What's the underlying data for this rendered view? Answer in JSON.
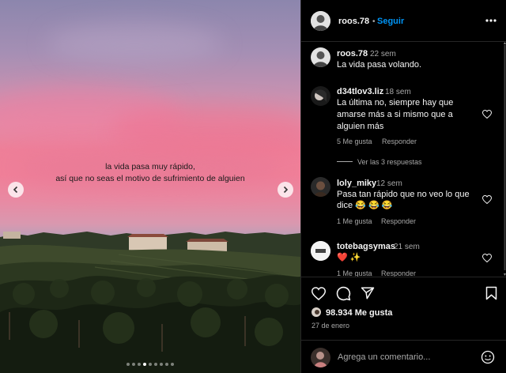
{
  "photo": {
    "caption_line1": "la vida pasa muy rápido,",
    "caption_line2": "así que no seas el motivo de sufrimiento de alguien",
    "dots_total": 9,
    "dots_active_index": 3
  },
  "header": {
    "username": "roos.78",
    "separator": "•",
    "follow_label": "Seguir"
  },
  "caption_post": {
    "username": "roos.78",
    "time": "22 sem",
    "text": "La vida pasa volando."
  },
  "comments": [
    {
      "username": "d34tlov3.liz",
      "time": "18 sem",
      "text_lines": [
        "La última no, siempre hay que",
        "amarse más a si mismo que a",
        "alguien más"
      ],
      "likes": "5 Me gusta",
      "reply": "Responder",
      "view_replies": "Ver las 3 respuestas"
    },
    {
      "username": "loly_miky",
      "time": "12 sem",
      "text_lines": [
        "Pasa tan rápido que no veo lo que",
        "dice 😂 😂 😂"
      ],
      "likes": "1 Me gusta",
      "reply": "Responder"
    },
    {
      "username": "totebagsymas",
      "time": "21 sem",
      "text_lines": [
        "❤️ ✨"
      ],
      "likes": "1 Me gusta",
      "reply": "Responder"
    }
  ],
  "stats": {
    "likes": "98.934 Me gusta",
    "date": "27 de enero"
  },
  "comment_input": {
    "placeholder": "Agrega un comentario..."
  },
  "colors": {
    "accent": "#0095f6",
    "text": "#f5f5f5",
    "muted": "#a8a8a8",
    "divider": "#262626"
  },
  "icons": {
    "more": "more-options-icon",
    "prev": "chevron-left-icon",
    "next": "chevron-right-icon",
    "like": "heart-icon",
    "comment": "comment-icon",
    "share": "paper-plane-icon",
    "save": "bookmark-icon",
    "emoji": "emoji-icon"
  }
}
